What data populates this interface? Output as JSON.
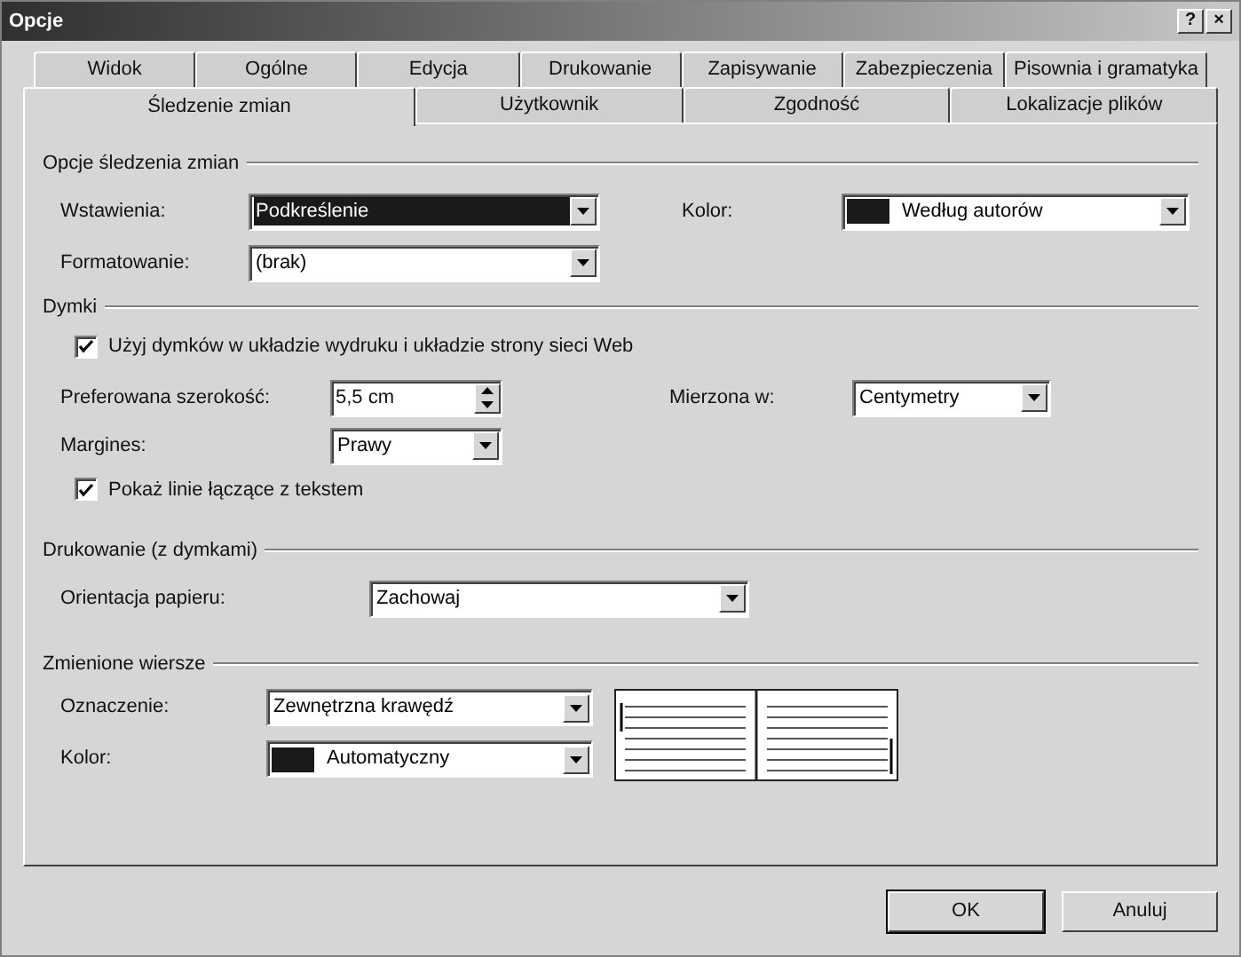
{
  "window": {
    "title": "Opcje",
    "controls": [
      "?",
      "×"
    ]
  },
  "tab_rows": [
    [
      {
        "label": "Widok",
        "selected": false
      },
      {
        "label": "Ogólne",
        "selected": false
      },
      {
        "label": "Edycja",
        "selected": false
      },
      {
        "label": "Drukowanie",
        "selected": false
      },
      {
        "label": "Zapisywanie",
        "selected": false
      },
      {
        "label": "Zabezpieczenia",
        "selected": false
      },
      {
        "label": "Pisownia i gramatyka",
        "selected": false
      }
    ],
    [
      {
        "label": "Śledzenie zmian",
        "selected": true
      },
      {
        "label": "Użytkownik",
        "selected": false
      },
      {
        "label": "Zgodność",
        "selected": false
      },
      {
        "label": "Lokalizacje plików",
        "selected": false
      }
    ]
  ],
  "track_changes": {
    "title": "Opcje śledzenia zmian",
    "insertions": {
      "label": "Wstawienia:",
      "value": "Podkreślenie",
      "focused": true
    },
    "formatting": {
      "label": "Formatowanie:",
      "value": "(brak)",
      "focused": false
    },
    "color": {
      "label": "Kolor:",
      "value": "Według autorów",
      "focused": false
    }
  },
  "balloons": {
    "title": "Dymki",
    "use_balloons": {
      "label": "Użyj dymków w układzie wydruku i układzie strony sieci Web",
      "checked": true
    },
    "width": {
      "label": "Preferowana szerokość:",
      "value": "5,5 cm"
    },
    "measure_in": {
      "label": "Mierzona w:",
      "value": "Centymetry"
    },
    "margin": {
      "label": "Margines:",
      "value": "Prawy"
    },
    "show_lines": {
      "label": "Pokaż linie łączące z tekstem",
      "checked": true
    }
  },
  "printing": {
    "title": "Drukowanie (z dymkami)",
    "orientation": {
      "label": "Orientacja papieru:",
      "value": "Zachowaj"
    }
  },
  "changed_lines": {
    "title": "Zmienione wiersze",
    "mark": {
      "label": "Oznaczenie:",
      "value": "Zewnętrzna krawędź"
    },
    "color": {
      "label": "Kolor:",
      "value": "Automatyczny"
    }
  },
  "buttons": [
    "OK",
    "Anuluj"
  ]
}
